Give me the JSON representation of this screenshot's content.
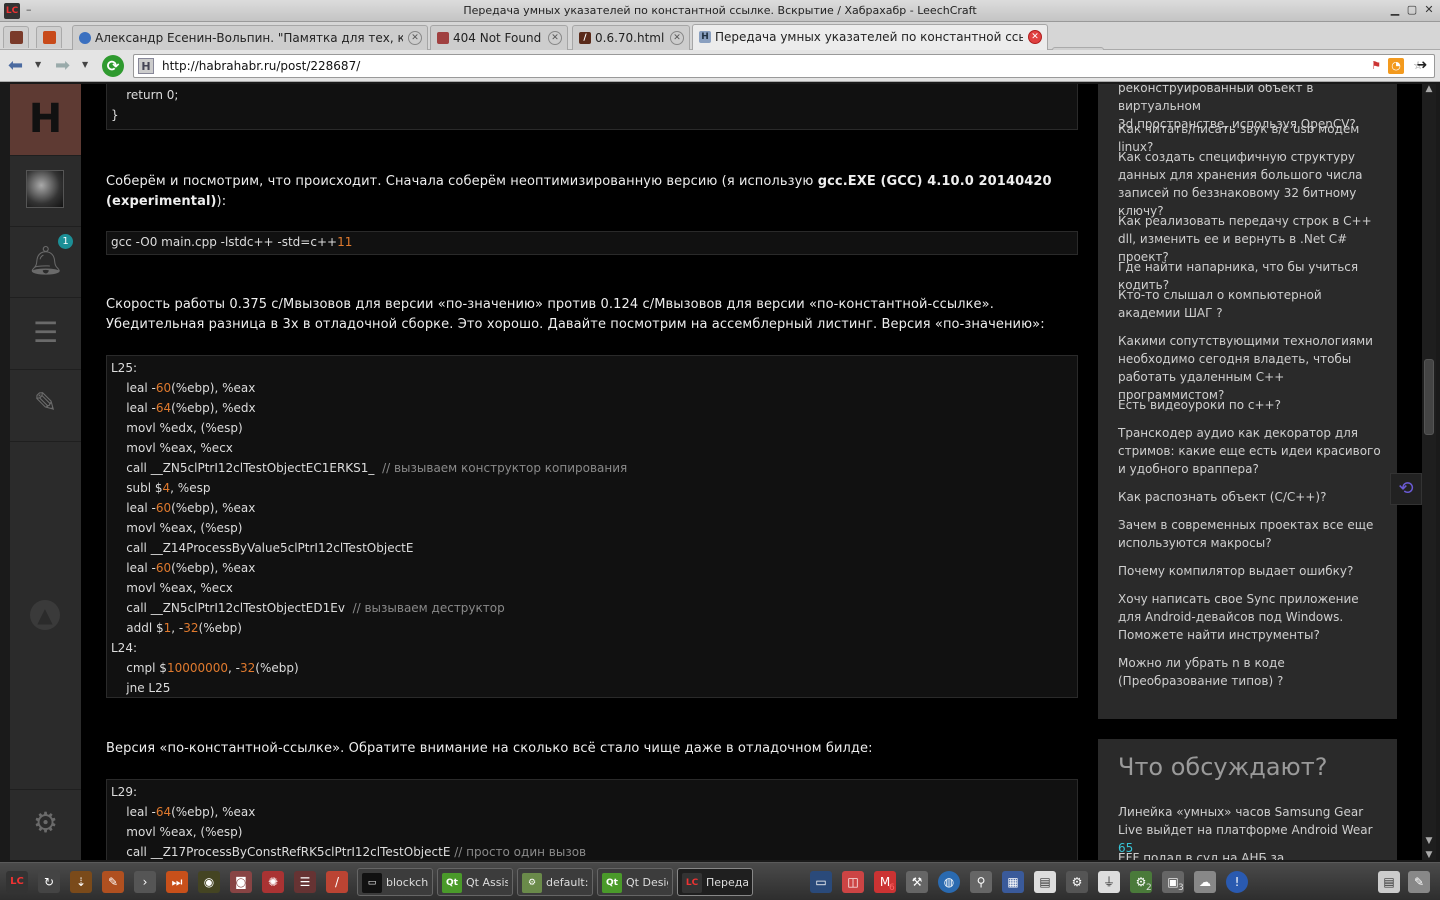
{
  "window": {
    "title": "Передача умных указателей по константной ссылке. Вскрытие / Хабрахабр - LeechCraft",
    "app_badge": "LC",
    "menu_dash": "–"
  },
  "tabs": [
    {
      "label": "Александр Есенин-Вольпин. \"Памятка для тех, ко..."
    },
    {
      "label": "404 Not Found"
    },
    {
      "label": "0.6.70.html"
    },
    {
      "label": "Передача умных указателей по константной ссы..."
    }
  ],
  "address": {
    "url": "http://habrahabr.ru/post/228687/",
    "site_letter": "H"
  },
  "rail": {
    "logo": "H",
    "badge_count": "1"
  },
  "code_top": [
    "    return 0;",
    "}"
  ],
  "para1": {
    "text": "Соберём и посмотрим, что происходит. Сначала соберём неоптимизированную версию (я использую ",
    "bold": "gcc.EXE (GCC) 4.10.0 20140420 (experimental)",
    "end": "):"
  },
  "cmd": {
    "text": "gcc -O0 main.cpp -lstdc++ -std=c++",
    "num": "11"
  },
  "para2": {
    "line1": "Скорость работы 0.375 с/Мвызовов для версии «по-значению» против 0.124 с/Мвызовов для версии «по-константной-ссылке».",
    "line2": "Убедительная разница в 3х в отладочной сборке. Это хорошо. Давайте посмотрим на ассемблерный листинг. Версия «по-значению»:"
  },
  "asm1": [
    {
      "a": "L25:",
      "n": "",
      "b": "",
      "c": ""
    },
    {
      "a": "    leal -",
      "n": "60",
      "b": "(%ebp), %eax",
      "c": ""
    },
    {
      "a": "    leal -",
      "n": "64",
      "b": "(%ebp), %edx",
      "c": ""
    },
    {
      "a": "    movl %edx, (%esp)",
      "n": "",
      "b": "",
      "c": ""
    },
    {
      "a": "    movl %eax, %ecx",
      "n": "",
      "b": "",
      "c": ""
    },
    {
      "a": "    call __ZN5clPtrI12clTestObjectEC1ERKS1_  ",
      "n": "",
      "b": "",
      "c": "// вызываем конструктор копирования"
    },
    {
      "a": "    subl $",
      "n": "4",
      "b": ", %esp",
      "c": ""
    },
    {
      "a": "    leal -",
      "n": "60",
      "b": "(%ebp), %eax",
      "c": ""
    },
    {
      "a": "    movl %eax, (%esp)",
      "n": "",
      "b": "",
      "c": ""
    },
    {
      "a": "    call __Z14ProcessByValue5clPtrI12clTestObjectE",
      "n": "",
      "b": "",
      "c": ""
    },
    {
      "a": "    leal -",
      "n": "60",
      "b": "(%ebp), %eax",
      "c": ""
    },
    {
      "a": "    movl %eax, %ecx",
      "n": "",
      "b": "",
      "c": ""
    },
    {
      "a": "    call __ZN5clPtrI12clTestObjectED1Ev  ",
      "n": "",
      "b": "",
      "c": "// вызываем деструктор"
    },
    {
      "a": "    addl $",
      "n": "1",
      "b": ", -",
      "n2": "32",
      "b2": "(%ebp)",
      "c": ""
    },
    {
      "a": "L24:",
      "n": "",
      "b": "",
      "c": ""
    },
    {
      "a": "    cmpl $",
      "n": "10000000",
      "b": ", -",
      "n2": "32",
      "b2": "(%ebp)",
      "c": ""
    },
    {
      "a": "    jne L25",
      "n": "",
      "b": "",
      "c": ""
    }
  ],
  "para3": "Версия «по-константной-ссылке». Обратите внимание на сколько всё стало чище даже в отладочном билде:",
  "asm2": [
    {
      "a": "L29:",
      "n": "",
      "b": "",
      "c": ""
    },
    {
      "a": "    leal -",
      "n": "64",
      "b": "(%ebp), %eax",
      "c": ""
    },
    {
      "a": "    movl %eax, (%esp)",
      "n": "",
      "b": "",
      "c": ""
    },
    {
      "a": "    call __Z17ProcessByConstRefRK5clPtrI12clTestObjectE ",
      "n": "",
      "b": "",
      "c": "// просто один вызов"
    }
  ],
  "sidebar": {
    "partial_top": [
      "реконструированный объект в виртуальном",
      "3d пространстве, используя OpenCV?"
    ],
    "questions": [
      "Как читать/писать звук в/с usb модем linux?",
      "Как создать специфичную структуру данных для хранения большого числа записей по беззнаковому 32 битному ключу?",
      "Как реализовать передачу строк в C++ dll, изменить ее и вернуть в .Net C# проект?",
      "Где найти напарника, что бы учиться кодить?",
      "Кто-то слышал о компьютерной академии ШАГ ?",
      "Какими сопутствующими технологиями необходимо сегодня владеть, чтобы работать удаленным C++ программистом?",
      "Есть видеоуроки по с++?",
      "Транскодер аудио как декоратор для стримов: какие еще есть идеи красивого и удобного враппера?",
      "Как распознать объект (C/C++)?",
      "Зачем в современных проектах все еще используются макросы?",
      "Почему компилятор выдает ошибку?",
      "Хочу написать свое Sync приложение для Android-девайсов под Windows. Поможете найти инструменты?",
      "Можно ли убрать n в коде (Преобразование типов) ?"
    ],
    "discuss_heading": "Что обсуждают?",
    "discuss": [
      {
        "text": "Линейка «умных» часов Samsung Gear Live выйдет на платформе Android Wear",
        "count": "65"
      },
      {
        "text": "EFF подал в суд на АНБ за неразглашение",
        "count": ""
      }
    ]
  },
  "taskbar": {
    "tasks": [
      {
        "label": "blockch..."
      },
      {
        "label": "Qt Assis..."
      },
      {
        "label": "default: ..."
      },
      {
        "label": "Qt Desig..."
      },
      {
        "label": "Переда..."
      }
    ],
    "tray_badges": [
      "6",
      "2",
      "3"
    ]
  }
}
